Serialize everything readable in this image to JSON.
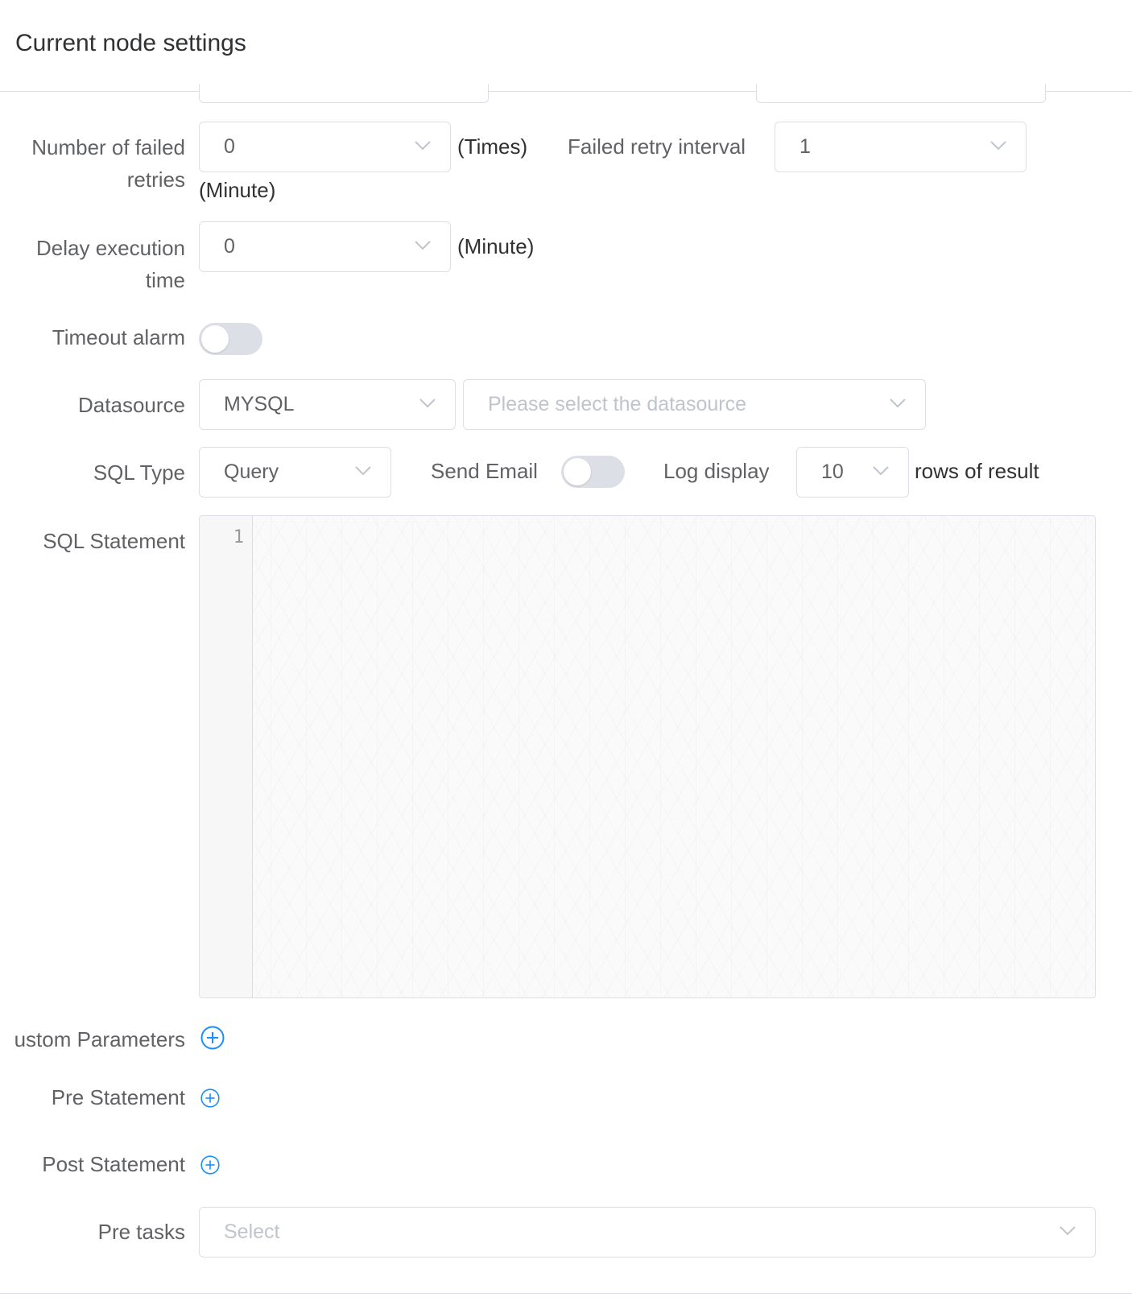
{
  "header": {
    "title": "Current node settings"
  },
  "retries": {
    "label": "Number of failed retries",
    "value": "0",
    "unit": "(Times)",
    "interval_label": "Failed retry interval",
    "interval_value": "1",
    "interval_unit": "(Minute)"
  },
  "delay": {
    "label": "Delay execution time",
    "value": "0",
    "unit": "(Minute)"
  },
  "timeout": {
    "label": "Timeout alarm",
    "enabled": false
  },
  "datasource": {
    "label": "Datasource",
    "type_value": "MYSQL",
    "placeholder": "Please select the datasource"
  },
  "sql": {
    "type_label": "SQL Type",
    "type_value": "Query",
    "send_email_label": "Send Email",
    "send_email_enabled": false,
    "log_display_label": "Log display",
    "log_display_value": "10",
    "rows_label": "rows of result"
  },
  "statement": {
    "label": "SQL Statement",
    "line_number": "1"
  },
  "custom_params": {
    "label": "ustom Parameters"
  },
  "pre_statement": {
    "label": "Pre Statement"
  },
  "post_statement": {
    "label": "Post Statement"
  },
  "pre_tasks": {
    "label": "Pre tasks",
    "placeholder": "Select"
  },
  "icons": {
    "chevron": "chevron-down-icon",
    "add": "plus-circle-icon",
    "accent": "#1890ff"
  }
}
